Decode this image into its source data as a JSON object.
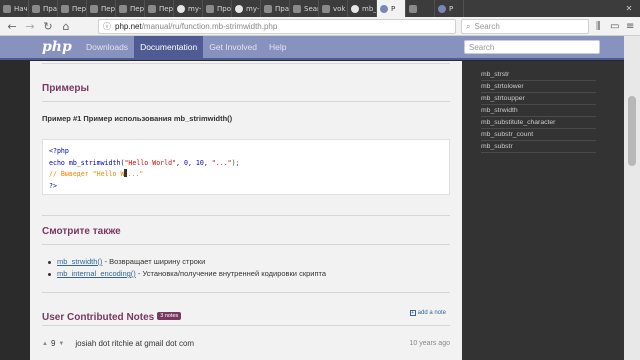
{
  "browser": {
    "tabs": [
      {
        "label": "Нач",
        "kind": "plain"
      },
      {
        "label": "Пра",
        "kind": "plain"
      },
      {
        "label": "Пер",
        "kind": "plain"
      },
      {
        "label": "Пер",
        "kind": "plain"
      },
      {
        "label": "Пер",
        "kind": "plain"
      },
      {
        "label": "Пер",
        "kind": "plain"
      },
      {
        "label": "my-",
        "kind": "gh"
      },
      {
        "label": "Прос",
        "kind": "plain"
      },
      {
        "label": "my-l",
        "kind": "gh"
      },
      {
        "label": "Пра",
        "kind": "plain"
      },
      {
        "label": "Sear",
        "kind": "plain"
      },
      {
        "label": "vok",
        "kind": "plain"
      },
      {
        "label": "mb_",
        "kind": "gh"
      },
      {
        "label": "P",
        "kind": "php"
      },
      {
        "label": "",
        "kind": "plain"
      },
      {
        "label": "P",
        "kind": "php"
      }
    ],
    "url_host": "php.net",
    "url_path": "/manual/ru/function.mb-strimwidth.php",
    "search_placeholder": "Search"
  },
  "site": {
    "logo": "php",
    "nav": [
      "Downloads",
      "Documentation",
      "Get Involved",
      "Help"
    ],
    "active_nav": "Documentation",
    "search_placeholder": "Search"
  },
  "sidebar": {
    "items": [
      "mb_strstr",
      "mb_strtolower",
      "mb_strtoupper",
      "mb_strwidth",
      "mb_substitute_character",
      "mb_substr_count",
      "mb_substr"
    ]
  },
  "examples": {
    "heading": "Примеры",
    "example_title": "Пример #1 Пример использования mb_strimwidth()",
    "code_line1": "<?php",
    "code_line2_fn": "echo mb_strimwidth(",
    "code_line2_str": "\"Hello World\"",
    "code_line2_args": ", 0, 10, ",
    "code_line2_str2": "\"...\"",
    "code_line2_end": ");",
    "code_line3_a": "// Выведет \"Hello W",
    "code_line3_b": "...\"",
    "code_line4": "?>"
  },
  "see_also": {
    "heading": "Смотрите также",
    "items": [
      {
        "link": "mb_strwidth()",
        "desc": " - Возвращает ширину строки"
      },
      {
        "link": "mb_internal_encoding()",
        "desc": " - Установка/получение внутренней кодировки скрипта"
      }
    ]
  },
  "notes": {
    "heading": "User Contributed Notes",
    "count": "3 notes",
    "add_note": "add a note",
    "first": {
      "votes": "9",
      "author": "josiah dot ritchie at gmail dot com",
      "ago": "10 years ago"
    }
  }
}
